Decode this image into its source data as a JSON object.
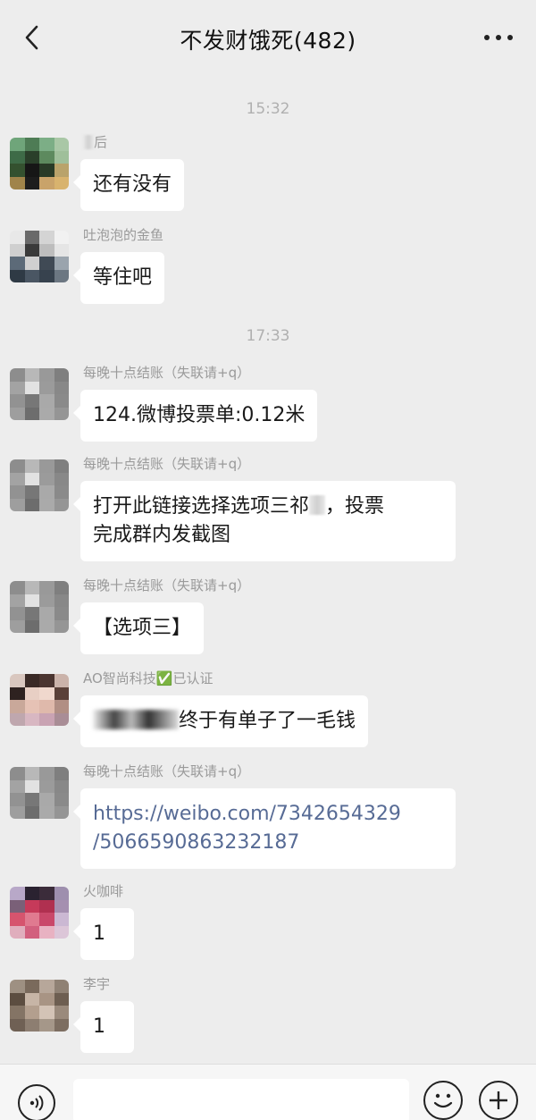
{
  "header": {
    "title": "不发财饿死(482)",
    "back_icon": "chevron-left-icon",
    "more_icon": "more-dots-icon"
  },
  "timestamps": [
    "15:32",
    "17:33"
  ],
  "messages": [
    {
      "sender": "后",
      "text": "还有没有"
    },
    {
      "sender": "吐泡泡的金鱼",
      "text": "等住吧"
    },
    {
      "sender": "每晚十点结账（失联请+q）",
      "text": "124.微博投票单:0.12米"
    },
    {
      "sender": "每晚十点结账（失联请+q）",
      "line1a": "打开此链接选择选项三祁",
      "line1b": "，投票",
      "line2": "完成群内发截图"
    },
    {
      "sender": "每晚十点结账（失联请+q）",
      "text": "【选项三】"
    },
    {
      "sender": "AO智尚科技✅已认证",
      "text": "终于有单子了一毛钱"
    },
    {
      "sender": "每晚十点结账（失联请+q）",
      "line1": "https://weibo.com/7342654329",
      "line2": "/5066590863232187"
    },
    {
      "sender": "火咖啡",
      "text": "1"
    },
    {
      "sender": "李宇",
      "text": "1"
    }
  ],
  "input_bar": {
    "voice_icon": "voice-icon",
    "emoji_icon": "emoji-icon",
    "plus_icon": "plus-icon"
  },
  "colors": {
    "background": "#ededed",
    "bubble": "#ffffff",
    "link": "#576b95"
  }
}
